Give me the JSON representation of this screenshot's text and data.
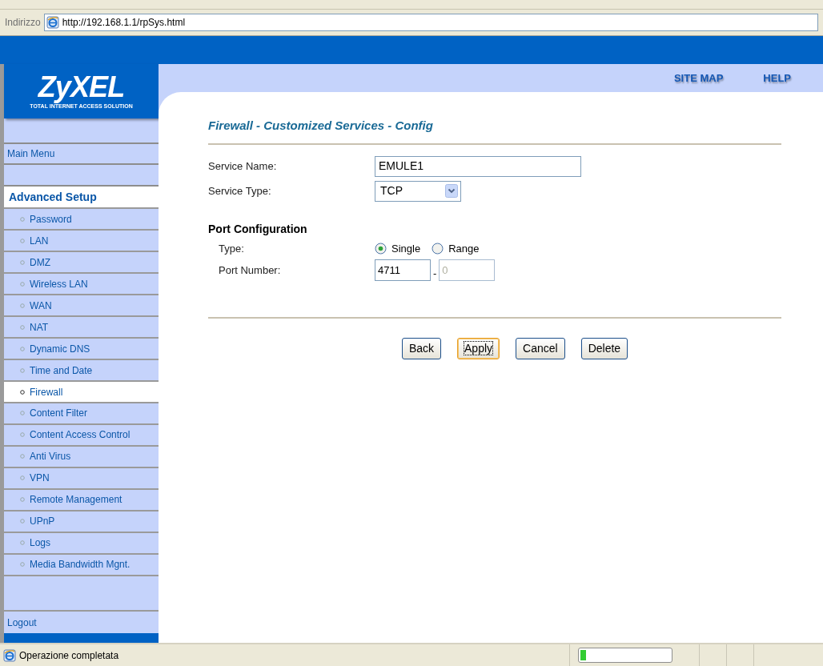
{
  "address_bar": {
    "label": "Indirizzo",
    "url": "http://192.168.1.1/rpSys.html"
  },
  "logo": {
    "name": "ZyXEL",
    "tagline": "TOTAL INTERNET ACCESS SOLUTION"
  },
  "header_links": [
    "SITE MAP",
    "HELP"
  ],
  "sidebar": {
    "main_menu": "Main Menu",
    "section": "Advanced Setup",
    "items": [
      {
        "label": "Password",
        "selected": false
      },
      {
        "label": "LAN",
        "selected": false
      },
      {
        "label": "DMZ",
        "selected": false
      },
      {
        "label": "Wireless LAN",
        "selected": false
      },
      {
        "label": "WAN",
        "selected": false
      },
      {
        "label": "NAT",
        "selected": false
      },
      {
        "label": "Dynamic DNS",
        "selected": false
      },
      {
        "label": "Time and Date",
        "selected": false
      },
      {
        "label": "Firewall",
        "selected": true
      },
      {
        "label": "Content Filter",
        "selected": false
      },
      {
        "label": "Content Access Control",
        "selected": false
      },
      {
        "label": "Anti Virus",
        "selected": false
      },
      {
        "label": "VPN",
        "selected": false
      },
      {
        "label": "Remote Management",
        "selected": false
      },
      {
        "label": "UPnP",
        "selected": false
      },
      {
        "label": "Logs",
        "selected": false
      },
      {
        "label": "Media Bandwidth Mgnt.",
        "selected": false
      }
    ],
    "logout": "Logout"
  },
  "form": {
    "title": "Firewall - Customized Services - Config",
    "service_name": {
      "label": "Service Name:",
      "value": "EMULE1"
    },
    "service_type": {
      "label": "Service Type:",
      "value": "TCP"
    },
    "port_section": "Port Configuration",
    "type": {
      "label": "Type:",
      "options": [
        {
          "label": "Single",
          "selected": true
        },
        {
          "label": "Range",
          "selected": false
        }
      ]
    },
    "port_number": {
      "label": "Port Number:",
      "from": "4711",
      "separator": "-",
      "to": "0",
      "to_disabled": true
    }
  },
  "buttons": [
    {
      "label": "Back",
      "focused": false
    },
    {
      "label": "Apply",
      "focused": true
    },
    {
      "label": "Cancel",
      "focused": false
    },
    {
      "label": "Delete",
      "focused": false
    }
  ],
  "status_bar": {
    "text": "Operazione completata",
    "level": 0.06
  }
}
